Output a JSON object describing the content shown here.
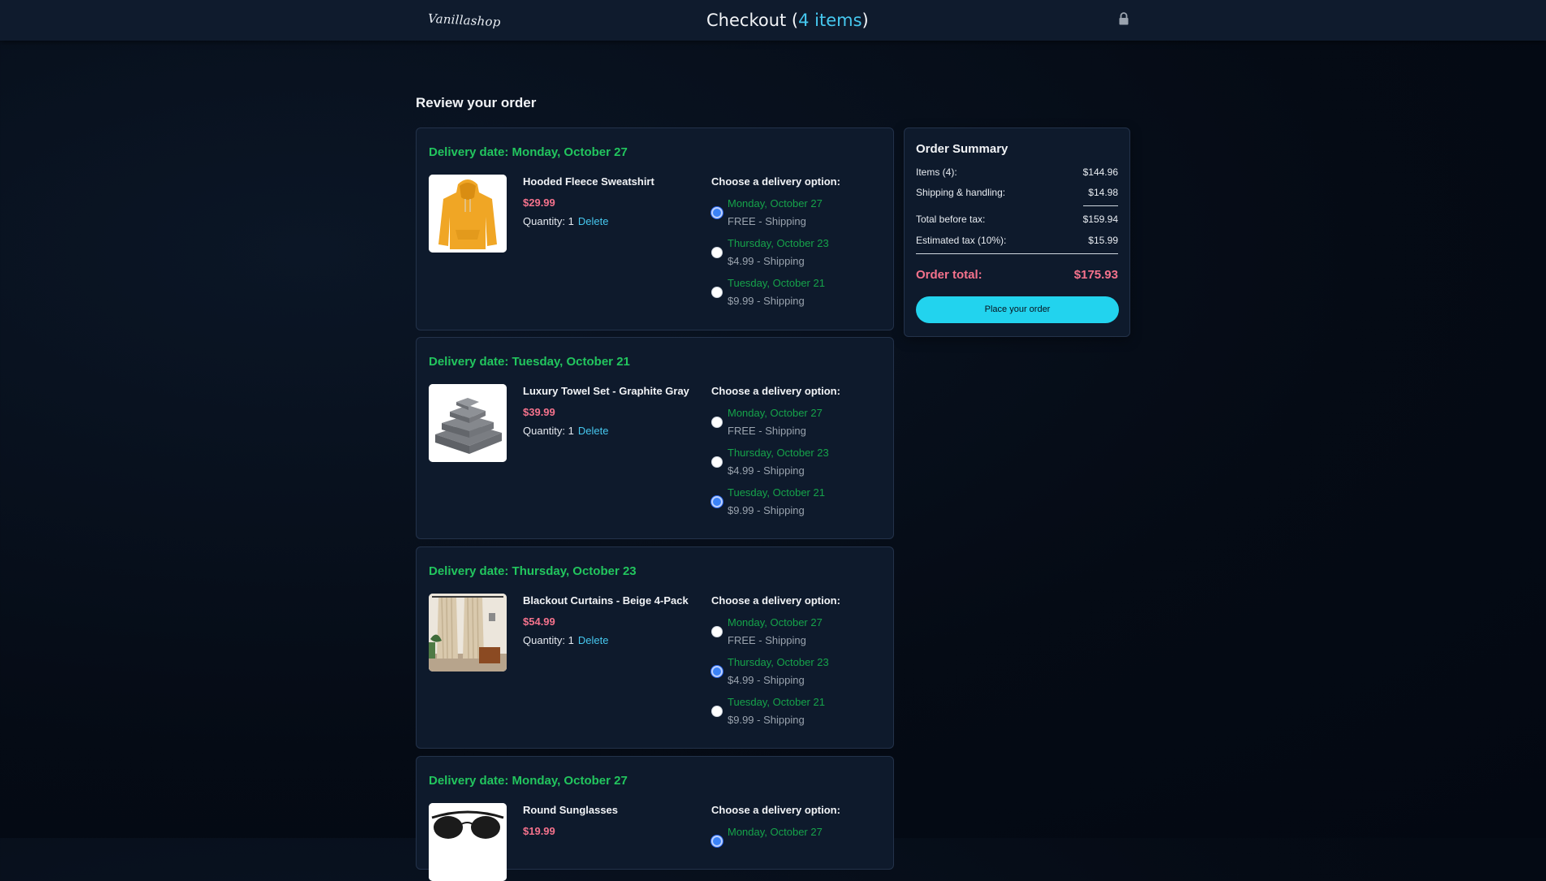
{
  "header": {
    "logo": "Vanillashop",
    "title_prefix": "Checkout (",
    "item_count": "4 items",
    "title_suffix": ")",
    "lock_icon": "lock-icon"
  },
  "main": {
    "review_heading": "Review your order",
    "option_heading": "Choose a delivery option:",
    "quantity_label": "Quantity: 1",
    "delete_label": "Delete",
    "orders": [
      {
        "delivery_date": "Delivery date: Monday, October 27",
        "product_name": "Hooded Fleece Sweatshirt",
        "price": "$29.99",
        "image": "yellow-hoodie-image",
        "options": [
          {
            "date": "Monday, October 27",
            "price": "FREE - Shipping",
            "checked": true
          },
          {
            "date": "Thursday, October 23",
            "price": "$4.99 - Shipping",
            "checked": false
          },
          {
            "date": "Tuesday, October 21",
            "price": "$9.99 - Shipping",
            "checked": false
          }
        ]
      },
      {
        "delivery_date": "Delivery date: Tuesday, October 21",
        "product_name": "Luxury Towel Set - Graphite Gray",
        "price": "$39.99",
        "image": "gray-towels-image",
        "options": [
          {
            "date": "Monday, October 27",
            "price": "FREE - Shipping",
            "checked": false
          },
          {
            "date": "Thursday, October 23",
            "price": "$4.99 - Shipping",
            "checked": false
          },
          {
            "date": "Tuesday, October 21",
            "price": "$9.99 - Shipping",
            "checked": true
          }
        ]
      },
      {
        "delivery_date": "Delivery date: Thursday, October 23",
        "product_name": "Blackout Curtains - Beige 4-Pack",
        "price": "$54.99",
        "image": "beige-curtains-image",
        "options": [
          {
            "date": "Monday, October 27",
            "price": "FREE - Shipping",
            "checked": false
          },
          {
            "date": "Thursday, October 23",
            "price": "$4.99 - Shipping",
            "checked": true
          },
          {
            "date": "Tuesday, October 21",
            "price": "$9.99 - Shipping",
            "checked": false
          }
        ]
      },
      {
        "delivery_date": "Delivery date: Monday, October 27",
        "product_name": "Round Sunglasses",
        "price": "$19.99",
        "image": "sunglasses-image",
        "options": [
          {
            "date": "Monday, October 27",
            "price": "",
            "checked": true
          }
        ]
      }
    ]
  },
  "summary": {
    "title": "Order Summary",
    "items_label": "Items (4):",
    "items_value": "$144.96",
    "shipping_label": "Shipping & handling:",
    "shipping_value": "$14.98",
    "before_tax_label": "Total before tax:",
    "before_tax_value": "$159.94",
    "tax_label": "Estimated tax (10%):",
    "tax_value": "$15.99",
    "total_label": "Order total:",
    "total_value": "$175.93",
    "place_order_label": "Place your order"
  },
  "colors": {
    "accent": "#22d3ee",
    "delivery_green": "#22c55e",
    "price_pink": "#f4728c",
    "link_blue": "#46c8ef"
  }
}
